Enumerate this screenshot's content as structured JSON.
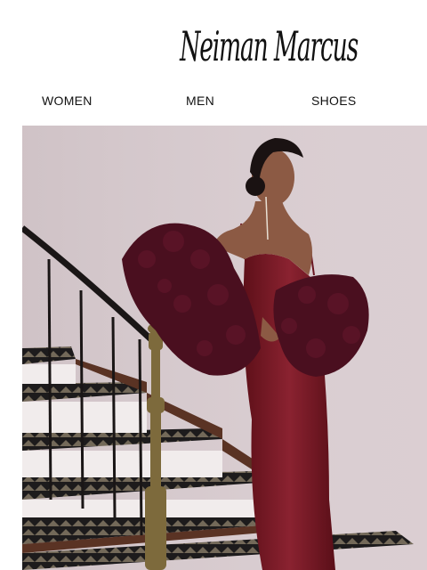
{
  "brand": {
    "name": "Neiman Marcus"
  },
  "nav": {
    "items": [
      {
        "label": "WOMEN"
      },
      {
        "label": "MEN"
      },
      {
        "label": "SHOES"
      }
    ]
  },
  "hero": {
    "colors": {
      "wall": "#d9ccd0",
      "dress": "#7a1a26",
      "fur": "#4a0f1f",
      "railing": "#1a1616",
      "newel_post": "#7d6a3c",
      "stair_runner": "#1d1b1c",
      "stair_wood": "#5a3324",
      "skin": "#8c5a44"
    }
  }
}
